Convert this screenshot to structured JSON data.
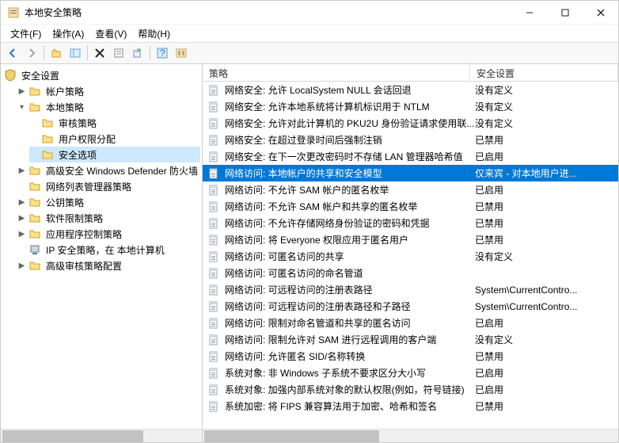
{
  "window": {
    "title": "本地安全策略"
  },
  "menu": {
    "file": "文件(F)",
    "action": "操作(A)",
    "view": "查看(V)",
    "help": "帮助(H)"
  },
  "columns": {
    "policy": "策略",
    "setting": "安全设置"
  },
  "tree": {
    "root": "安全设置",
    "account": "帐户策略",
    "local": "本地策略",
    "audit": "审核策略",
    "rights": "用户权限分配",
    "options": "安全选项",
    "defender": "高级安全 Windows Defender 防火墙",
    "netlist": "网络列表管理器策略",
    "pubkey": "公钥策略",
    "software": "软件限制策略",
    "appctl": "应用程序控制策略",
    "ipsec": "IP 安全策略，在 本地计算机",
    "advaudit": "高级审核策略配置"
  },
  "policies": [
    {
      "name": "网络安全: 允许 LocalSystem NULL 会话回退",
      "value": "没有定义"
    },
    {
      "name": "网络安全: 允许本地系统将计算机标识用于 NTLM",
      "value": "没有定义"
    },
    {
      "name": "网络安全: 允许对此计算机的 PKU2U 身份验证请求使用联...",
      "value": "没有定义"
    },
    {
      "name": "网络安全: 在超过登录时间后强制注销",
      "value": "已禁用"
    },
    {
      "name": "网络安全: 在下一次更改密码时不存储 LAN 管理器哈希值",
      "value": "已启用"
    },
    {
      "name": "网络访问: 本地帐户的共享和安全模型",
      "value": "仅来宾 - 对本地用户进...",
      "selected": true
    },
    {
      "name": "网络访问: 不允许 SAM 帐户的匿名枚举",
      "value": "已启用"
    },
    {
      "name": "网络访问: 不允许 SAM 帐户和共享的匿名枚举",
      "value": "已禁用"
    },
    {
      "name": "网络访问: 不允许存储网络身份验证的密码和凭据",
      "value": "已禁用"
    },
    {
      "name": "网络访问: 将 Everyone 权限应用于匿名用户",
      "value": "已禁用"
    },
    {
      "name": "网络访问: 可匿名访问的共享",
      "value": "没有定义"
    },
    {
      "name": "网络访问: 可匿名访问的命名管道",
      "value": ""
    },
    {
      "name": "网络访问: 可远程访问的注册表路径",
      "value": "System\\CurrentContro..."
    },
    {
      "name": "网络访问: 可远程访问的注册表路径和子路径",
      "value": "System\\CurrentContro..."
    },
    {
      "name": "网络访问: 限制对命名管道和共享的匿名访问",
      "value": "已启用"
    },
    {
      "name": "网络访问: 限制允许对 SAM 进行远程调用的客户端",
      "value": "没有定义"
    },
    {
      "name": "网络访问: 允许匿名 SID/名称转换",
      "value": "已禁用"
    },
    {
      "name": "系统对象: 非 Windows 子系统不要求区分大小写",
      "value": "已启用"
    },
    {
      "name": "系统对象: 加强内部系统对象的默认权限(例如，符号链接)",
      "value": "已启用"
    },
    {
      "name": "系统加密: 将 FIPS 兼容算法用于加密、哈希和签名",
      "value": "已禁用"
    }
  ]
}
